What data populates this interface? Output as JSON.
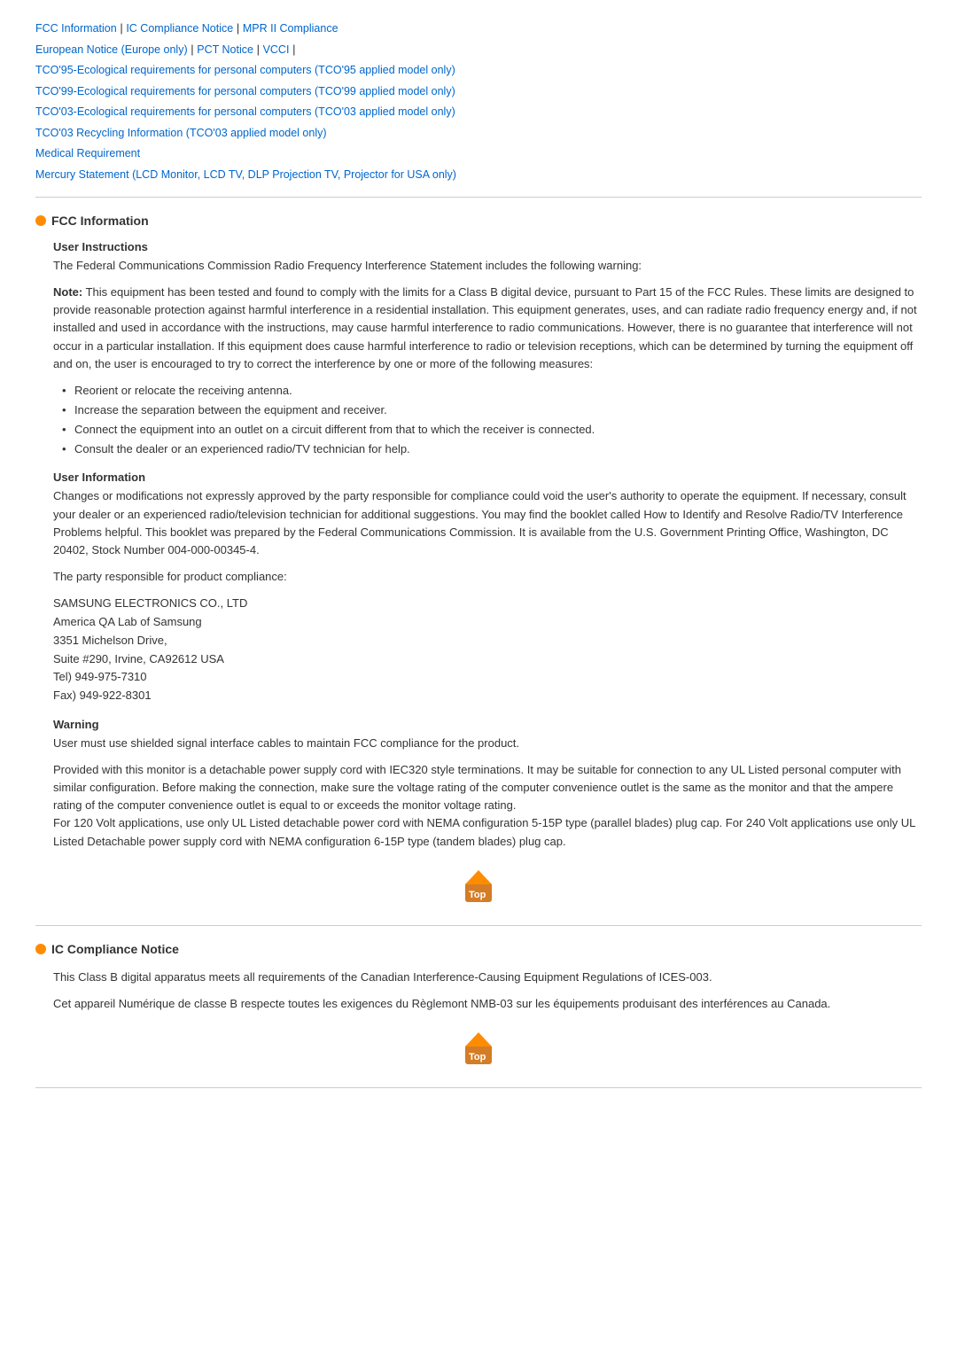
{
  "nav": {
    "links": [
      {
        "label": "FCC Information",
        "id": "fcc"
      },
      {
        "label": "IC Compliance Notice",
        "id": "ic"
      },
      {
        "label": "MPR II Compliance",
        "id": "mpr"
      },
      {
        "label": "European Notice (Europe only)",
        "id": "european"
      },
      {
        "label": "PCT Notice",
        "id": "pct"
      },
      {
        "label": "VCCI",
        "id": "vcci"
      },
      {
        "label": "TCO'95-Ecological requirements for personal computers (TCO'95 applied model only)",
        "id": "tco95"
      },
      {
        "label": "TCO'99-Ecological requirements for personal computers (TCO'99 applied model only)",
        "id": "tco99"
      },
      {
        "label": "TCO'03-Ecological requirements for personal computers (TCO'03 applied model only)",
        "id": "tco03"
      },
      {
        "label": "TCO'03 Recycling Information (TCO'03 applied model only)",
        "id": "tco03r"
      },
      {
        "label": "Medical Requirement",
        "id": "medical"
      },
      {
        "label": "Mercury Statement (LCD Monitor, LCD TV, DLP Projection TV, Projector for USA only)",
        "id": "mercury"
      }
    ]
  },
  "fcc_section": {
    "title": "FCC Information",
    "user_instructions": {
      "subtitle": "User Instructions",
      "intro": "The Federal Communications Commission Radio Frequency Interference Statement includes the following warning:",
      "note_text": "Note: This equipment has been tested and found to comply with the limits for a Class B digital device, pursuant to Part 15 of the FCC Rules. These limits are designed to provide reasonable protection against harmful interference in a residential installation. This equipment generates, uses, and can radiate radio frequency energy and, if not installed and used in accordance with the instructions, may cause harmful interference to radio communications. However, there is no guarantee that interference will not occur in a particular installation. If this equipment does cause harmful interference to radio or television receptions, which can be determined by turning the equipment off and on, the user is encouraged to try to correct the interference by one or more of the following measures:",
      "measures": [
        "Reorient or relocate the receiving antenna.",
        "Increase the separation between the equipment and receiver.",
        "Connect the equipment into an outlet on a circuit different from that to which the receiver is connected.",
        "Consult the dealer or an experienced radio/TV technician for help."
      ]
    },
    "user_information": {
      "subtitle": "User Information",
      "para1": "Changes or modifications not expressly approved by the party responsible for compliance could void the user's authority to operate the equipment. If necessary, consult your dealer or an experienced radio/television technician for additional suggestions. You may find the booklet called How to Identify and Resolve Radio/TV Interference Problems helpful. This booklet was prepared by the Federal Communications Commission. It is available from the U.S. Government Printing Office, Washington, DC 20402, Stock Number 004-000-00345-4.",
      "para2": "The party responsible for product compliance:",
      "company": "SAMSUNG ELECTRONICS CO., LTD\nAmerica QA Lab of Samsung\n3351 Michelson Drive,\nSuite #290, Irvine, CA92612 USA\nTel) 949-975-7310\nFax) 949-922-8301"
    },
    "warning": {
      "subtitle": "Warning",
      "para1": "User must use shielded signal interface cables to maintain FCC compliance for the product.",
      "para2": "Provided with this monitor is a detachable power supply cord with IEC320 style terminations. It may be suitable for connection to any UL Listed personal computer with similar configuration. Before making the connection, make sure the voltage rating of the computer convenience outlet is the same as the monitor and that the ampere rating of the computer convenience outlet is equal to or exceeds the monitor voltage rating.\nFor 120 Volt applications, use only UL Listed detachable power cord with NEMA configuration 5-15P type (parallel blades) plug cap. For 240 Volt applications use only UL Listed Detachable power supply cord with NEMA configuration 6-15P type (tandem blades) plug cap."
    }
  },
  "ic_section": {
    "title": "IC Compliance Notice",
    "para1": "This Class B digital apparatus meets all requirements of the Canadian Interference-Causing Equipment Regulations of ICES-003.",
    "para2": "Cet appareil Numérique de classe B respecte toutes les exigences du Règlemont NMB-03 sur les équipements produisant des interférences au Canada."
  },
  "top_button_label": "Top"
}
